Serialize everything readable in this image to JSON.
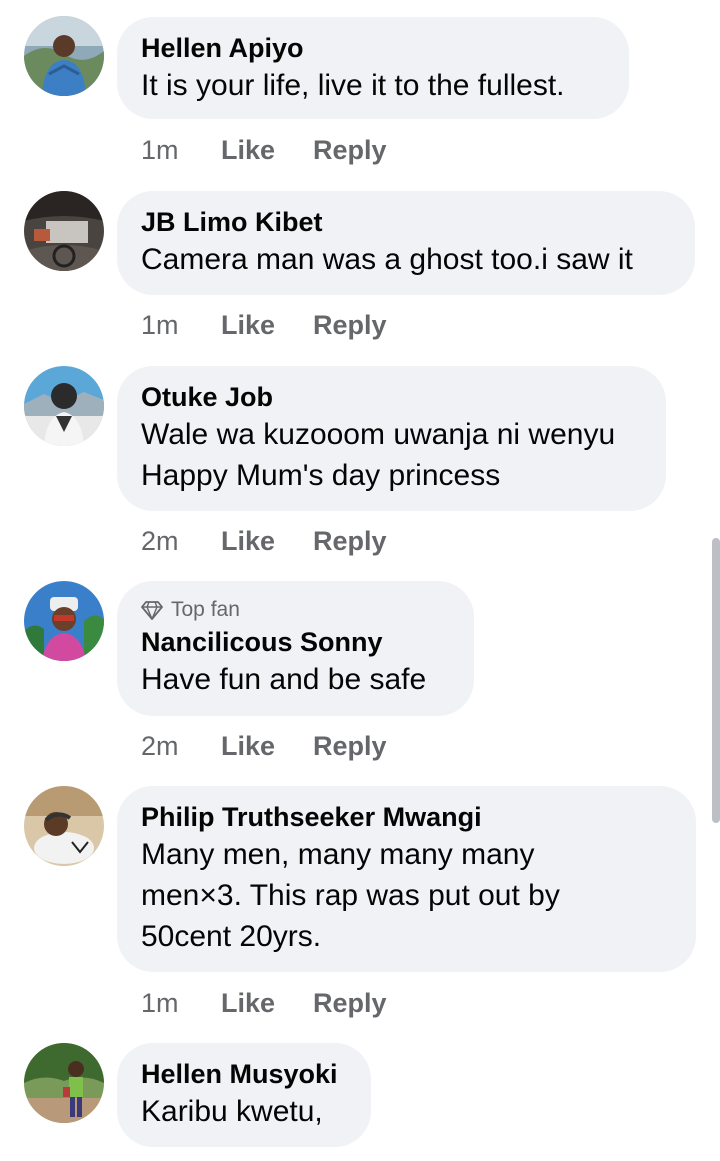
{
  "comments": [
    {
      "author": "Hellen Apiyo",
      "text": "It is your life, live it to the fullest.",
      "time": "1m",
      "like": "Like",
      "reply": "Reply"
    },
    {
      "author": "JB Limo Kibet",
      "text": "Camera man was a ghost too.i saw it",
      "time": "1m",
      "like": "Like",
      "reply": "Reply"
    },
    {
      "author": "Otuke Job",
      "text": "Wale wa kuzooom uwanja ni wenyu\nHappy Mum's day princess",
      "time": "2m",
      "like": "Like",
      "reply": "Reply"
    },
    {
      "badge": "Top fan",
      "author": "Nancilicous Sonny",
      "text": "Have fun and be safe",
      "time": "2m",
      "like": "Like",
      "reply": "Reply"
    },
    {
      "author": "Philip Truthseeker Mwangi",
      "text": "Many men, many many many\nmen×3. This rap was put out by\n50cent 20yrs.",
      "time": "1m",
      "like": "Like",
      "reply": "Reply"
    },
    {
      "author": "Hellen Musyoki",
      "text": "Karibu kwetu,"
    }
  ],
  "colors": {
    "bubble_bg": "#f0f2f5",
    "meta_text": "#65676b",
    "primary_text": "#050505"
  }
}
